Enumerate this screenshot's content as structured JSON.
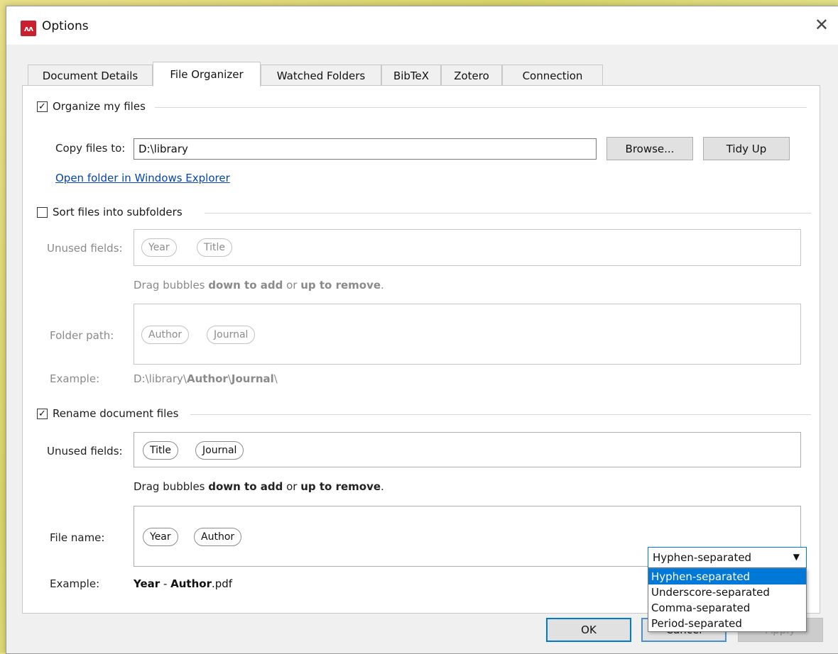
{
  "window": {
    "title": "Options",
    "app_icon": "mendeley-logo-icon",
    "app_logo_text": "ʌʌ",
    "close_glyph": "✕"
  },
  "tabs": [
    {
      "label": "Document Details",
      "active": false
    },
    {
      "label": "File Organizer",
      "active": true
    },
    {
      "label": "Watched Folders",
      "active": false
    },
    {
      "label": "BibTeX",
      "active": false
    },
    {
      "label": "Zotero",
      "active": false
    },
    {
      "label": "Connection",
      "active": false
    }
  ],
  "organize": {
    "label": "Organize my files",
    "checked": true,
    "copy_label": "Copy files to:",
    "path_value": "D:\\library",
    "browse_label": "Browse...",
    "tidy_label": "Tidy Up",
    "open_link": "Open folder in Windows Explorer"
  },
  "subfolders": {
    "label": "Sort files into subfolders",
    "checked": false,
    "unused_label": "Unused fields:",
    "unused_bubbles": [
      "Year",
      "Title"
    ],
    "hint_pre": "Drag bubbles ",
    "hint_b1": "down to add",
    "hint_mid": " or ",
    "hint_b2": "up to remove",
    "hint_post": ".",
    "folder_label": "Folder path:",
    "folder_bubbles": [
      "Author",
      "Journal"
    ],
    "example_label": "Example:",
    "example_prefix": "D:\\library\\",
    "example_b1": "Author",
    "example_sep": "\\",
    "example_b2": "Journal",
    "example_suffix": "\\"
  },
  "rename": {
    "label": "Rename document files",
    "checked": true,
    "unused_label": "Unused fields:",
    "unused_bubbles": [
      "Title",
      "Journal"
    ],
    "hint_pre": "Drag bubbles ",
    "hint_b1": "down to add",
    "hint_mid": " or ",
    "hint_b2": "up to remove",
    "hint_post": ".",
    "filename_label": "File name:",
    "filename_bubbles": [
      "Year",
      "Author"
    ],
    "example_label": "Example:",
    "example_b1": "Year",
    "example_sep": " - ",
    "example_b2": "Author",
    "example_suffix": ".pdf",
    "separator_selected": "Hyphen-separated",
    "separator_options": [
      "Hyphen-separated",
      "Underscore-separated",
      "Comma-separated",
      "Period-separated"
    ]
  },
  "footer": {
    "ok": "OK",
    "cancel": "Cancel",
    "apply": "Apply"
  },
  "colors": {
    "accent": "#0078d7",
    "link": "#0645ad",
    "brand": "#cc1f2d"
  }
}
